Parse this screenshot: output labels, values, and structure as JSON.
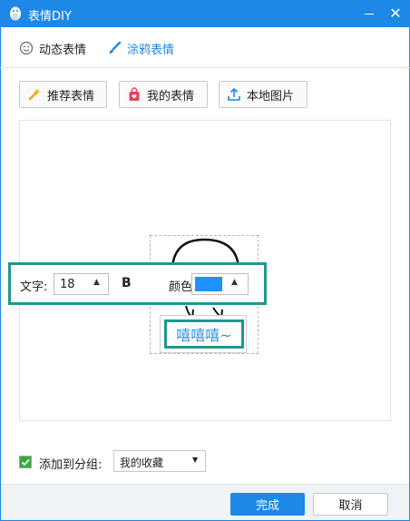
{
  "window": {
    "title": "表情DIY",
    "close_glyph": "✕"
  },
  "modes": {
    "dynamic": "动态表情",
    "graffiti": "涂鸦表情"
  },
  "toolbar": {
    "recommend": "推荐表情",
    "mine": "我的表情",
    "local": "本地图片"
  },
  "text_style": {
    "text_label": "文字:",
    "font_size": "18",
    "bold_label": "B",
    "color_label": "颜色:",
    "color_value": "#1e90ff",
    "arrow_glyph": "▲"
  },
  "sticker": {
    "caption": "嘻嘻嘻~"
  },
  "group": {
    "checked": true,
    "label": "添加到分组:",
    "selected": "我的收藏",
    "arrow_glyph": "▼"
  },
  "footer": {
    "finish_label": "完成",
    "cancel_label": "取消"
  },
  "colors": {
    "title_bar": "#1d88e6",
    "highlight": "#1b9a8c",
    "accent_text": "#2e8fde",
    "check": "#3ca83c"
  },
  "icons": {
    "app": "penguin-icon",
    "dynamic": "smiley-icon",
    "graffiti": "brush-icon",
    "recommend": "wand-icon",
    "mine": "bag-icon",
    "local": "upload-icon"
  }
}
